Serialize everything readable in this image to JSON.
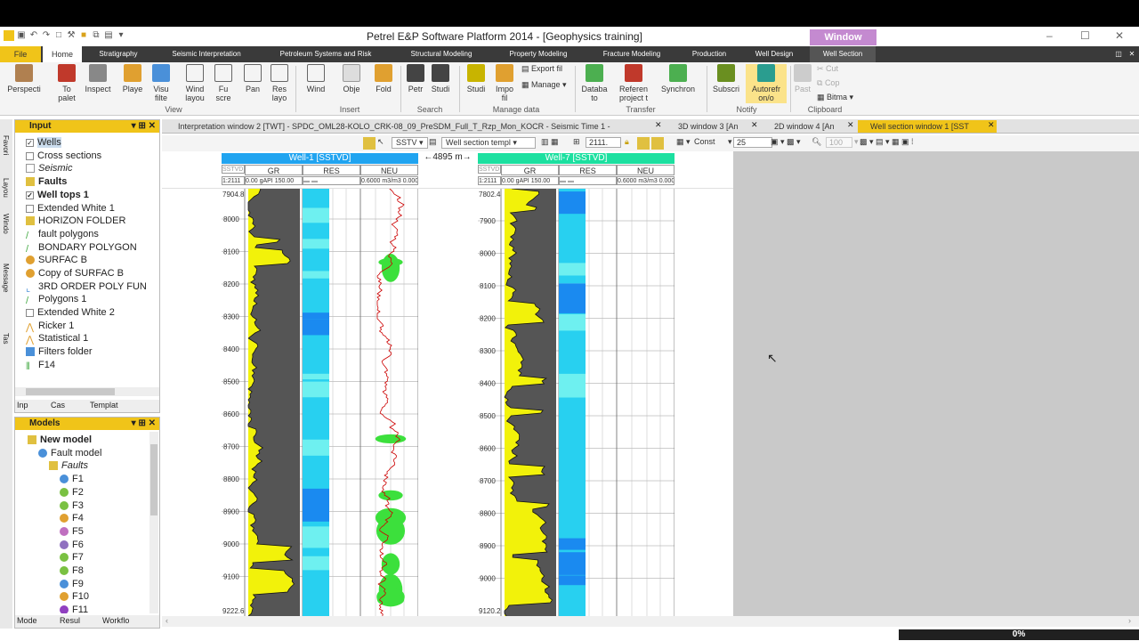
{
  "window": {
    "title": "Petrel E&P Software Platform 2014 - [Geophysics training]",
    "context_tab": "Window"
  },
  "ribbon_tabs": [
    "File",
    "Home",
    "Stratigraphy",
    "Seismic Interpretation",
    "Petroleum Systems and Risk",
    "Structural Modeling",
    "Property Modeling",
    "Fracture Modeling",
    "Production",
    "Well Design",
    "Well Section"
  ],
  "ribbon": {
    "buttons": [
      "Perspecti",
      "To palet",
      "Inspect",
      "Playe",
      "Visu filte",
      "Wind layou",
      "Fu scre",
      "Pan",
      "Res layo",
      "Wind",
      "Obje",
      "Fold",
      "Petr",
      "Studi",
      "Studi",
      "Impo fil",
      "Export fil",
      "Manage",
      "Databa to",
      "Referen project t",
      "Synchron",
      "Subscri",
      "Autorefr on/o",
      "Past",
      "Cut",
      "Cop",
      "Bitma"
    ],
    "groups": [
      "View",
      "Insert",
      "Search",
      "Manage data",
      "Transfer",
      "Notify",
      "Clipboard"
    ]
  },
  "input_panel": {
    "title": "Input",
    "items": [
      "Wells",
      "Cross sections",
      "Seismic",
      "Faults",
      "Well tops 1",
      "Extended White 1",
      "HORIZON FOLDER",
      "fault polygons",
      "BONDARY POLYGON",
      "SURFAC B",
      "Copy of SURFAC B",
      "3RD ORDER POLY FUN",
      "Polygons 1",
      "Extended White 2",
      "Ricker 1",
      "Statistical 1",
      "Filters folder",
      "F14"
    ],
    "bottom_tabs": [
      "Inp",
      "Cas",
      "Templat"
    ]
  },
  "models_panel": {
    "title": "Models",
    "items": [
      "New model",
      "Fault model",
      "Faults",
      "F1",
      "F2",
      "F3",
      "F4",
      "F5",
      "F6",
      "F7",
      "F8",
      "F9",
      "F10",
      "F11"
    ],
    "bottom_tabs": [
      "Mode",
      "Resul",
      "Workflo"
    ]
  },
  "side_tabs": [
    "Favori",
    "Layou",
    "Windo",
    "Message",
    "Tas"
  ],
  "document_tabs": [
    "Interpretation window 2 [TWT] - SPDC_OML28-KOLO_CRK-08_09_PreSDM_Full_T_Rzp_Mon_KOCR - Seismic Time 1 -",
    "3D window 3 [An",
    "2D window 4 [An",
    "Well section window 1 [SST"
  ],
  "well_toolbar": {
    "datum": "SSTV",
    "template": "Well section templ",
    "scale": "2111.",
    "mode": "Const",
    "value": "25",
    "zoom": "100"
  },
  "wells": [
    {
      "name": "Well-1 [SSTVD]",
      "scale": "1:2111",
      "gr_scale": "0.00 gAPI 150.00",
      "neu_scale": "0.6000 m3/m3 0.0000",
      "top_depth": "7904.8",
      "bottom_depth": "9222.6",
      "depths": [
        "8000",
        "8100",
        "8200",
        "8300",
        "8400",
        "8500",
        "8600",
        "8700",
        "8800",
        "8900",
        "9000",
        "9100"
      ]
    },
    {
      "name": "Well-7 [SSTVD]",
      "scale": "1:2111",
      "gr_scale": "0.00 gAPI 150.00",
      "neu_scale": "0.6000 m3/m3 0.0000",
      "top_depth": "7802.4",
      "bottom_depth": "9120.2",
      "depths": [
        "7900",
        "8000",
        "8100",
        "8200",
        "8300",
        "8400",
        "8500",
        "8600",
        "8700",
        "8800",
        "8900",
        "9000"
      ]
    }
  ],
  "track_labels": [
    "GR",
    "RES",
    "NEU"
  ],
  "md_label": "SSTVD",
  "well_distance": "4895 m",
  "status": {
    "progress": "0%"
  }
}
